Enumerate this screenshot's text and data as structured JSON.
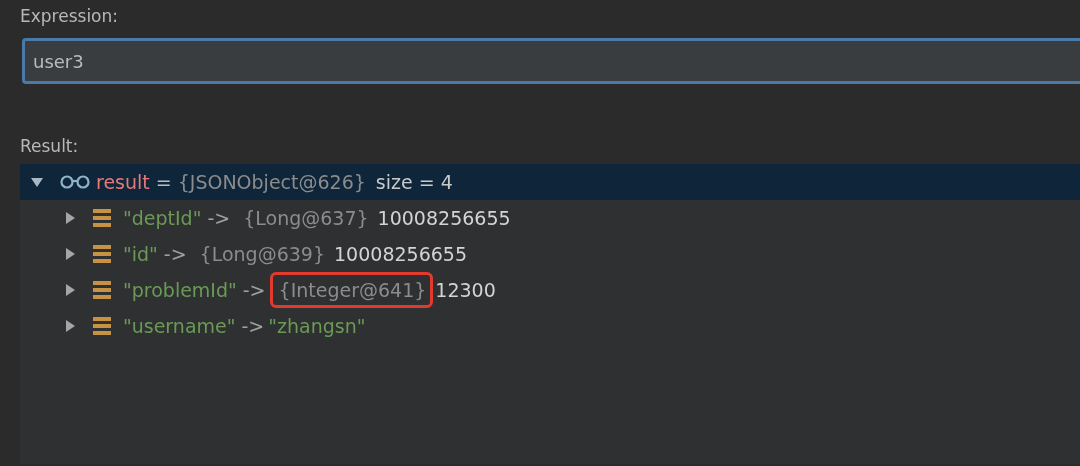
{
  "expression": {
    "label": "Expression:",
    "value": "user3"
  },
  "result": {
    "label": "Result:",
    "root": {
      "name": "result",
      "separator": "=",
      "type": "{JSONObject@626}",
      "size": "size = 4",
      "selected": true,
      "expanded": true,
      "children": [
        {
          "key": "\"deptId\"",
          "arrow": "->",
          "type": "{Long@637}",
          "value": "10008256655",
          "kind": "number",
          "highlighted": false,
          "expanded": false
        },
        {
          "key": "\"id\"",
          "arrow": "->",
          "type": "{Long@639}",
          "value": "10008256655",
          "kind": "number",
          "highlighted": false,
          "expanded": false
        },
        {
          "key": "\"problemId\"",
          "arrow": "->",
          "type": "{Integer@641}",
          "value": "12300",
          "kind": "number",
          "highlighted": true,
          "expanded": false
        },
        {
          "key": "\"username\"",
          "arrow": "->",
          "value": "\"zhangsn\"",
          "kind": "string",
          "expanded": false
        }
      ]
    }
  }
}
